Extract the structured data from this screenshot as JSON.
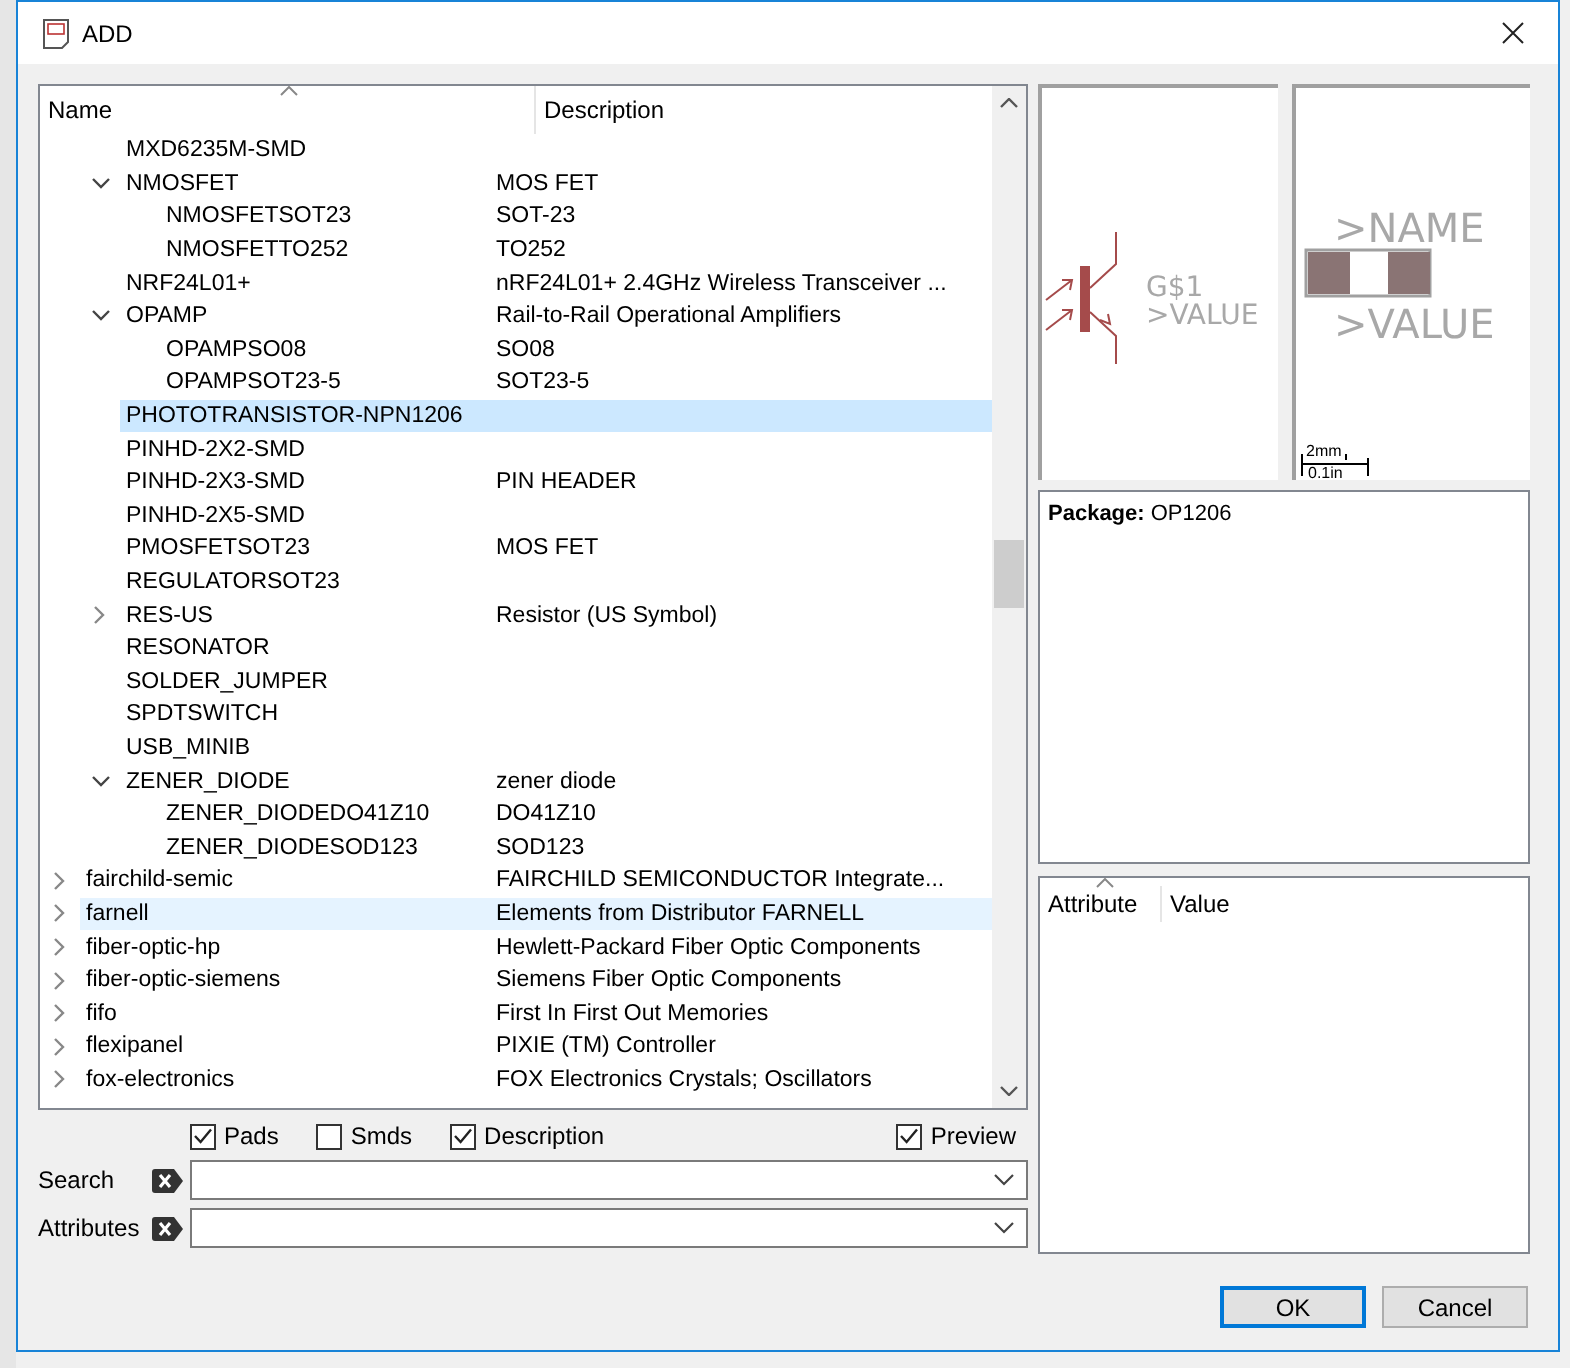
{
  "window": {
    "title": "ADD"
  },
  "tree": {
    "columns": [
      "Name",
      "Description"
    ],
    "continued_children": [
      {
        "name": "MXD6235M-SMD",
        "selected": false,
        "hovered": false
      },
      {
        "name": "NMOSFET",
        "description": "MOS FET",
        "expanded": true,
        "selected": false,
        "hovered": false,
        "children": [
          {
            "name": "NMOSFETSOT23",
            "description": "SOT-23",
            "selected": false,
            "hovered": false
          },
          {
            "name": "NMOSFETTO252",
            "description": "TO252",
            "selected": false,
            "hovered": false
          }
        ]
      },
      {
        "name": "NRF24L01+",
        "description": "nRF24L01+ 2.4GHz Wireless Transceiver ...",
        "selected": false,
        "hovered": false
      },
      {
        "name": "OPAMP",
        "description": "Rail-to-Rail Operational Amplifiers",
        "expanded": true,
        "selected": false,
        "hovered": false,
        "children": [
          {
            "name": "OPAMPSO08",
            "description": "SO08",
            "selected": false,
            "hovered": false
          },
          {
            "name": "OPAMPSOT23-5",
            "description": "SOT23-5",
            "selected": false,
            "hovered": false
          }
        ]
      },
      {
        "name": "PHOTOTRANSISTOR-NPN1206",
        "selected": true,
        "hovered": false
      },
      {
        "name": "PINHD-2X2-SMD",
        "selected": false,
        "hovered": false
      },
      {
        "name": "PINHD-2X3-SMD",
        "description": "PIN HEADER",
        "selected": false,
        "hovered": false
      },
      {
        "name": "PINHD-2X5-SMD",
        "selected": false,
        "hovered": false
      },
      {
        "name": "PMOSFETSOT23",
        "description": "MOS FET",
        "selected": false,
        "hovered": false
      },
      {
        "name": "REGULATORSOT23",
        "selected": false,
        "hovered": false
      },
      {
        "name": "RES-US",
        "description": "Resistor (US Symbol)",
        "expanded": false,
        "selected": false,
        "hovered": false
      },
      {
        "name": "RESONATOR",
        "selected": false,
        "hovered": false
      },
      {
        "name": "SOLDER_JUMPER",
        "selected": false,
        "hovered": false
      },
      {
        "name": "SPDTSWITCH",
        "selected": false,
        "hovered": false
      },
      {
        "name": "USB_MINIB",
        "selected": false,
        "hovered": false
      },
      {
        "name": "ZENER_DIODE",
        "description": "zener diode",
        "expanded": true,
        "selected": false,
        "hovered": false,
        "children": [
          {
            "name": "ZENER_DIODEDO41Z10",
            "description": "DO41Z10",
            "selected": false,
            "hovered": false
          },
          {
            "name": "ZENER_DIODESOD123",
            "description": "SOD123",
            "selected": false,
            "hovered": false
          }
        ]
      }
    ],
    "rows": [
      {
        "name": "fairchild-semic",
        "description": "FAIRCHILD SEMICONDUCTOR Integrate...",
        "expanded": false,
        "selected": false,
        "hovered": false
      },
      {
        "name": "farnell",
        "description": "Elements from Distributor FARNELL",
        "expanded": false,
        "selected": false,
        "hovered": true
      },
      {
        "name": "fiber-optic-hp",
        "description": "Hewlett-Packard Fiber Optic Components",
        "expanded": false,
        "selected": false,
        "hovered": false
      },
      {
        "name": "fiber-optic-siemens",
        "description": "Siemens Fiber Optic Components",
        "expanded": false,
        "selected": false,
        "hovered": false
      },
      {
        "name": "fifo",
        "description": "First In First Out Memories",
        "expanded": false,
        "selected": false,
        "hovered": false
      },
      {
        "name": "flexipanel",
        "description": "PIXIE (TM) Controller",
        "expanded": false,
        "selected": false,
        "hovered": false
      },
      {
        "name": "fox-electronics",
        "description": "FOX Electronics Crystals; Oscillators",
        "expanded": false,
        "selected": false,
        "hovered": false
      }
    ]
  },
  "checkboxes": [
    {
      "label": "Pads",
      "checked": true
    },
    {
      "label": "Smds",
      "checked": false
    },
    {
      "label": "Description",
      "checked": true
    },
    {
      "label": "Preview",
      "checked": true
    }
  ],
  "fields": [
    {
      "label": "Search"
    },
    {
      "label": "Attributes"
    }
  ],
  "symbol_preview": {
    "name_label": "G$1",
    "value_label": ">VALUE"
  },
  "package_preview": {
    "name_label": ">NAME",
    "value_label": ">VALUE",
    "scale_top": "2mm",
    "scale_bottom": "0.1in"
  },
  "package_info": "**Package:** OP1206",
  "attribute_table": {
    "columns": [
      "Attribute",
      "Value"
    ]
  },
  "buttons": [
    "OK",
    "Cancel"
  ]
}
